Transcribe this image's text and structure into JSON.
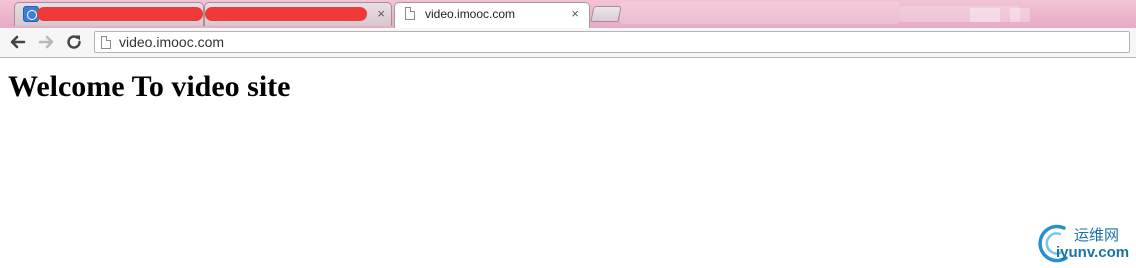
{
  "browser": {
    "tabs": [
      {
        "title": "",
        "redacted": true
      },
      {
        "title": "",
        "redacted": true
      },
      {
        "title": "video.imooc.com",
        "active": true
      }
    ],
    "close_glyph": "×",
    "address": "video.imooc.com"
  },
  "page": {
    "heading": "Welcome To video site"
  },
  "watermark": {
    "line1": "运维网",
    "line2": "iyunv.com"
  },
  "colors": {
    "titlebar": "#ebb5cb",
    "redaction": "#f03a3a",
    "watermark": "#1a73a6"
  }
}
